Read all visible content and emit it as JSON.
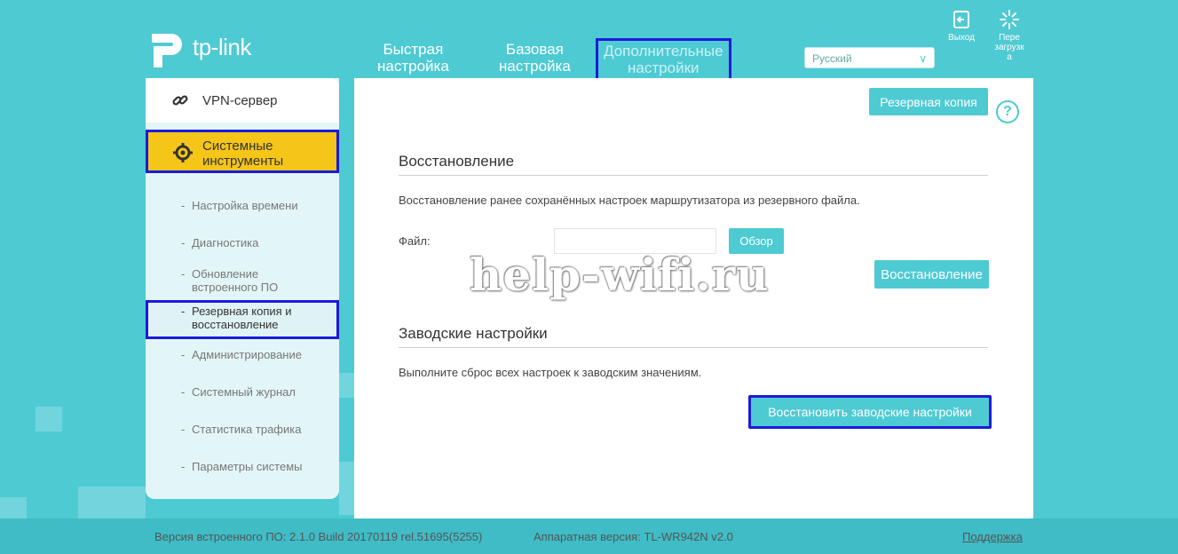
{
  "header": {
    "logo_text": "tp-link",
    "nav": [
      {
        "label_line1": "Быстрая",
        "label_line2": "настройка"
      },
      {
        "label_line1": "Базовая",
        "label_line2": "настройка"
      },
      {
        "label_line1": "Дополнительные",
        "label_line2": "настройки"
      }
    ],
    "language": "Русский",
    "logout_label": "Выход",
    "reboot_label_1": "Пере",
    "reboot_label_2": "загрузк",
    "reboot_label_3": "а"
  },
  "sidebar": {
    "vpn_label": "VPN-сервер",
    "system_tools_line1": "Системные",
    "system_tools_line2": "инструменты",
    "subitems": [
      {
        "line1": "Настройка времени",
        "line2": ""
      },
      {
        "line1": "Диагностика",
        "line2": ""
      },
      {
        "line1": "Обновление",
        "line2": "встроенного ПО"
      },
      {
        "line1": "Резервная копия и",
        "line2": "восстановление"
      },
      {
        "line1": "Администрирование",
        "line2": ""
      },
      {
        "line1": "Системный журнал",
        "line2": ""
      },
      {
        "line1": "Статистика трафика",
        "line2": ""
      },
      {
        "line1": "Параметры системы",
        "line2": ""
      }
    ]
  },
  "main": {
    "backup_button": "Резервная копия",
    "help_glyph": "?",
    "restore_title": "Восстановление",
    "restore_desc": "Восстановление ранее сохранённых настроек маршрутизатора из резервного файла.",
    "file_label": "Файл:",
    "browse_button": "Обзор",
    "restore_button": "Восстановление",
    "factory_title": "Заводские настройки",
    "factory_desc": "Выполните сброс всех настроек к заводским значениям.",
    "factory_button": "Восстановить заводские настройки",
    "watermark": "help-wifi.ru"
  },
  "footer": {
    "firmware": "Версия встроенного ПО: 2.1.0 Build 20170119 rel.51695(5255)",
    "hardware": "Аппаратная версия: TL-WR942N v2.0",
    "support": "Поддержка"
  },
  "colors": {
    "accent": "#4ecad3",
    "highlight": "#f5c518",
    "annotation_border": "#1a1adb"
  }
}
